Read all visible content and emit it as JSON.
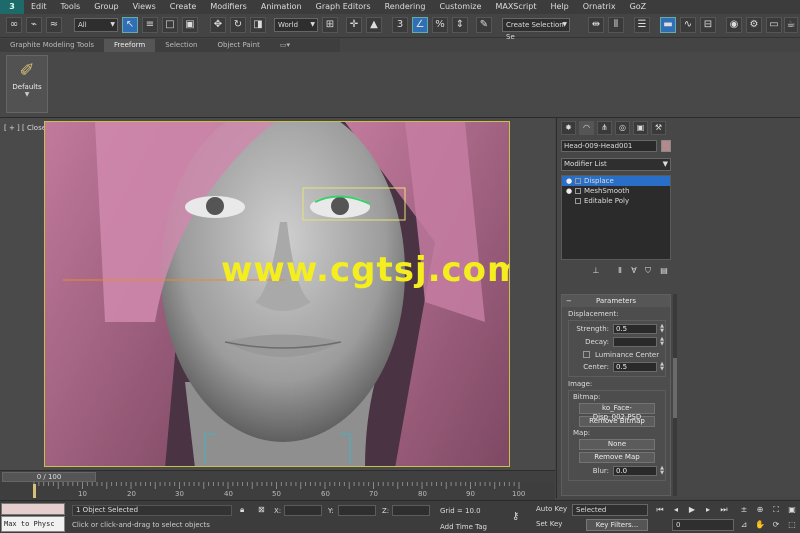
{
  "menu": {
    "logo": "3",
    "items": [
      "Edit",
      "Tools",
      "Group",
      "Views",
      "Create",
      "Modifiers",
      "Animation",
      "Graph Editors",
      "Rendering",
      "Customize",
      "MAXScript",
      "Help",
      "Ornatrix",
      "GoZ"
    ]
  },
  "toolbar": {
    "selection_filter": "All",
    "ref_coord": "World",
    "named_selection": "Create Selection Se",
    "snap_label": "3",
    "icons": [
      "link-icon",
      "unlink-icon",
      "bind-icon",
      "select-icon",
      "select-by-name-icon",
      "rect-select-icon",
      "window-crossing-icon",
      "move-icon",
      "rotate-icon",
      "scale-icon",
      "pivot-icon",
      "manipulate-icon",
      "snap-icon",
      "angle-snap-icon",
      "percent-snap-icon",
      "spinner-snap-icon",
      "mirror-icon",
      "align-icon",
      "layer-icon",
      "ribbon-toggle-icon",
      "curve-editor-icon",
      "schematic-icon",
      "material-editor-icon",
      "render-setup-icon",
      "render-frame-icon",
      "render-icon"
    ]
  },
  "ribbon": {
    "tabs": [
      "Graphite Modeling Tools",
      "Freeform",
      "Selection",
      "Object Paint"
    ],
    "active_tab": "Freeform",
    "defaults_label": "Defaults"
  },
  "viewport": {
    "label": "[ + ] [ CloseUp001 ] [ Smooth ]",
    "watermark": "www.cgtsj.com"
  },
  "command_panel": {
    "object_name": "Head-009-Head001",
    "object_color": "#b4898e",
    "modifier_list": "Modifier List",
    "stack": [
      {
        "label": "Displace",
        "selected": true
      },
      {
        "label": "MeshSmooth",
        "selected": false
      },
      {
        "label": "Editable Poly",
        "selected": false
      }
    ],
    "parameters_title": "Parameters",
    "displacement_group": "Displacement:",
    "strength_label": "Strength:",
    "strength_value": "0.5",
    "decay_label": "Decay:",
    "decay_value": "",
    "luminance_center": "Luminance Center",
    "center_label": "Center:",
    "center_value": "0.5",
    "image_group": "Image:",
    "bitmap_label": "Bitmap:",
    "bitmap_button": "ko_Face-Disp_002.PSD",
    "remove_bitmap": "Remove Bitmap",
    "map_label": "Map:",
    "map_button": "None",
    "remove_map": "Remove Map",
    "blur_label": "Blur:",
    "blur_value": "0.0"
  },
  "timeline": {
    "slider": "0 / 100",
    "ticks": [
      "10",
      "20",
      "30",
      "40",
      "50",
      "60",
      "70",
      "80",
      "90",
      "100"
    ]
  },
  "status": {
    "maxscript": "Max to Physc",
    "selection_count": "1 Object Selected",
    "prompt": "Click or click-and-drag to select objects",
    "x_label": "X:",
    "y_label": "Y:",
    "z_label": "Z:",
    "grid": "Grid = 10.0",
    "add_time_tag": "Add Time Tag",
    "auto_key": "Auto Key",
    "set_key": "Set Key",
    "selected_dropdown": "Selected",
    "key_filters": "Key Filters...",
    "current_frame": "0"
  }
}
